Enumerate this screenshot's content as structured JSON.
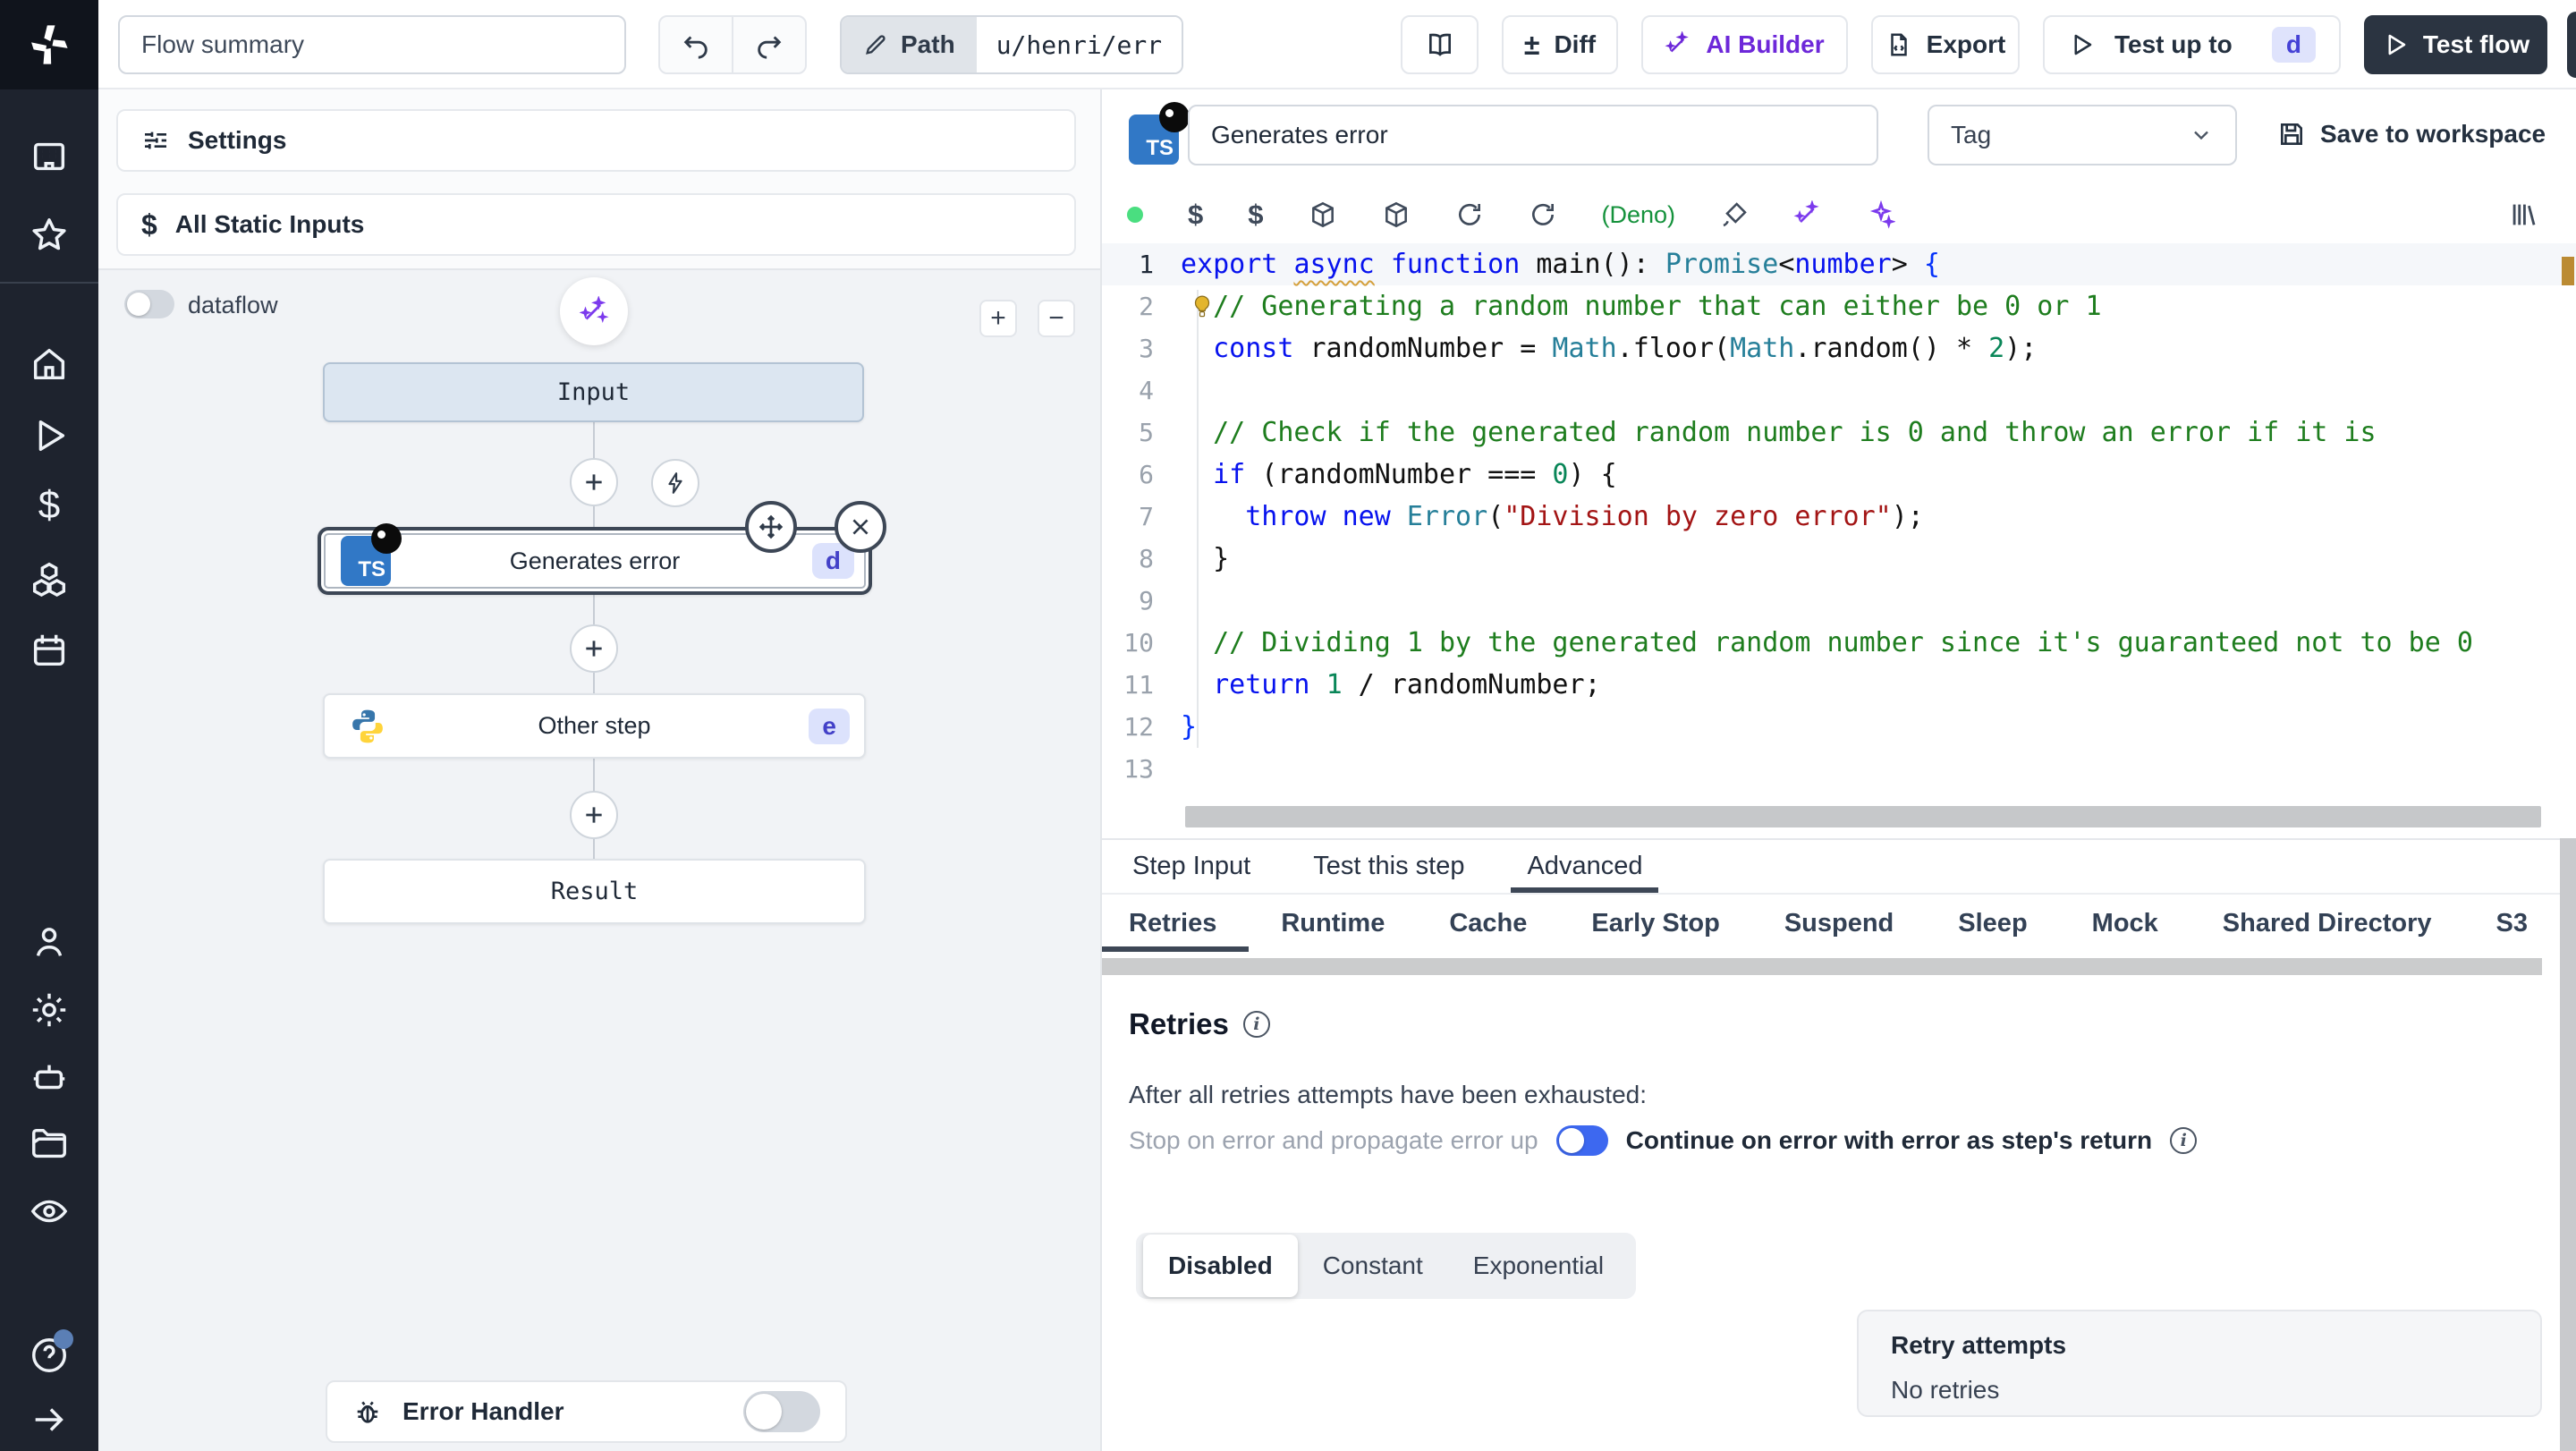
{
  "topbar": {
    "flow_summary": "Flow summary",
    "path_label": "Path",
    "path_value": "u/henri/err",
    "diff_label": "Diff",
    "diff_sign": "±",
    "ai_builder_label": "AI Builder",
    "export_label": "Export",
    "test_up_to_label": "Test up to",
    "test_up_to_badge": "d",
    "test_flow_label": "Test flow"
  },
  "left": {
    "settings_label": "Settings",
    "static_inputs_label": "All Static Inputs",
    "dataflow_label": "dataflow",
    "zoom_in": "+",
    "zoom_out": "−",
    "nodes": {
      "input": "Input",
      "step1_label": "Generates error",
      "step1_badge": "d",
      "step2_label": "Other step",
      "step2_badge": "e",
      "result": "Result"
    },
    "error_handler_label": "Error Handler"
  },
  "step": {
    "name": "Generates error",
    "tag_placeholder": "Tag",
    "save_label": "Save to workspace",
    "deno_label": "(Deno)",
    "ts_label": "TS"
  },
  "code": {
    "lines": [
      [
        [
          "kw",
          "export"
        ],
        [
          "pl",
          " "
        ],
        [
          "kwu",
          "async"
        ],
        [
          "pl",
          " "
        ],
        [
          "kw",
          "function"
        ],
        [
          "pl",
          " main(): "
        ],
        [
          "type",
          "Promise"
        ],
        [
          "pl",
          "<"
        ],
        [
          "kw",
          "number"
        ],
        [
          "pl",
          "> "
        ],
        [
          "brace",
          "{"
        ]
      ],
      [
        [
          "pl",
          "  "
        ],
        [
          "com",
          "// Generating a random number that can either be 0 or 1"
        ]
      ],
      [
        [
          "pl",
          "  "
        ],
        [
          "kw",
          "const"
        ],
        [
          "pl",
          " randomNumber = "
        ],
        [
          "type",
          "Math"
        ],
        [
          "pl",
          ".floor("
        ],
        [
          "type",
          "Math"
        ],
        [
          "pl",
          ".random() * "
        ],
        [
          "num",
          "2"
        ],
        [
          "pl",
          ");"
        ]
      ],
      [],
      [
        [
          "pl",
          "  "
        ],
        [
          "com",
          "// Check if the generated random number is 0 and throw an error if it is"
        ]
      ],
      [
        [
          "pl",
          "  "
        ],
        [
          "kw",
          "if"
        ],
        [
          "pl",
          " (randomNumber === "
        ],
        [
          "num",
          "0"
        ],
        [
          "pl",
          ") {"
        ]
      ],
      [
        [
          "pl",
          "    "
        ],
        [
          "kw",
          "throw"
        ],
        [
          "pl",
          " "
        ],
        [
          "kw",
          "new"
        ],
        [
          "pl",
          " "
        ],
        [
          "type",
          "Error"
        ],
        [
          "pl",
          "("
        ],
        [
          "str",
          "\"Division by zero error\""
        ],
        [
          "pl",
          ");"
        ]
      ],
      [
        [
          "pl",
          "  }"
        ]
      ],
      [],
      [
        [
          "pl",
          "  "
        ],
        [
          "com",
          "// Dividing 1 by the generated random number since it's guaranteed not to be 0"
        ]
      ],
      [
        [
          "pl",
          "  "
        ],
        [
          "kw",
          "return"
        ],
        [
          "pl",
          " "
        ],
        [
          "num",
          "1"
        ],
        [
          "pl",
          " / randomNumber;"
        ]
      ],
      [
        [
          "brace",
          "}"
        ]
      ],
      []
    ]
  },
  "panel": {
    "tabs": [
      "Step Input",
      "Test this step",
      "Advanced"
    ],
    "active_tab": 2,
    "advanced_tabs": [
      "Retries",
      "Runtime",
      "Cache",
      "Early Stop",
      "Suspend",
      "Sleep",
      "Mock",
      "Shared Directory",
      "S3"
    ],
    "active_advanced_tab": 0,
    "retries": {
      "title": "Retries",
      "intro": "After all retries attempts have been exhausted:",
      "stop_label": "Stop on error and propagate error up",
      "continue_label": "Continue on error with error as step's return",
      "modes": [
        "Disabled",
        "Constant",
        "Exponential"
      ],
      "active_mode": 0,
      "attempts_label": "Retry attempts",
      "attempts_value": "No retries"
    }
  },
  "colors": {
    "accent_indigo": "#4642d6",
    "ai_purple": "#6d28d9",
    "deno_green": "#15923c",
    "toggle_blue": "#3d68f0",
    "dark_button": "#2b3441",
    "selected_border": "#3d4756"
  }
}
